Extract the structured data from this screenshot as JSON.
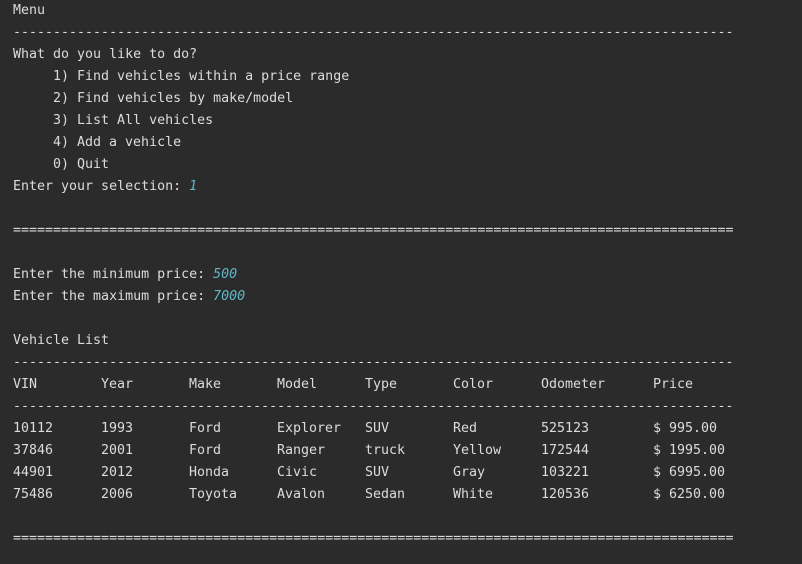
{
  "menu_title": "Menu",
  "dash_rule": "------------------------------------------------------------------------------------------",
  "equals_rule": "==========================================================================================",
  "prompt_question": "What do you like to do?",
  "menu_options": [
    "1) Find vehicles within a price range",
    "2) Find vehicles by make/model",
    "3) List All vehicles",
    "4) Add a vehicle",
    "0) Quit"
  ],
  "selection_prompt": "Enter your selection: ",
  "selection_value": "1",
  "min_price_prompt": "Enter the minimum price: ",
  "min_price_value": "500",
  "max_price_prompt": "Enter the maximum price: ",
  "max_price_value": "7000",
  "list_title": "Vehicle List",
  "table": {
    "headers": [
      "VIN",
      "Year",
      "Make",
      "Model",
      "Type",
      "Color",
      "Odometer",
      "Price"
    ],
    "rows": [
      [
        "10112",
        "1993",
        "Ford",
        "Explorer",
        "SUV",
        "Red",
        "525123",
        "$ 995.00"
      ],
      [
        "37846",
        "2001",
        "Ford",
        "Ranger",
        "truck",
        "Yellow",
        "172544",
        "$ 1995.00"
      ],
      [
        "44901",
        "2012",
        "Honda",
        "Civic",
        "SUV",
        "Gray",
        "103221",
        "$ 6995.00"
      ],
      [
        "75486",
        "2006",
        "Toyota",
        "Avalon",
        "Sedan",
        "White",
        "120536",
        "$ 6250.00"
      ]
    ]
  },
  "colors": {
    "background": "#2b2b2b",
    "text": "#dcdcdc",
    "user_input": "#5fb7c8"
  }
}
